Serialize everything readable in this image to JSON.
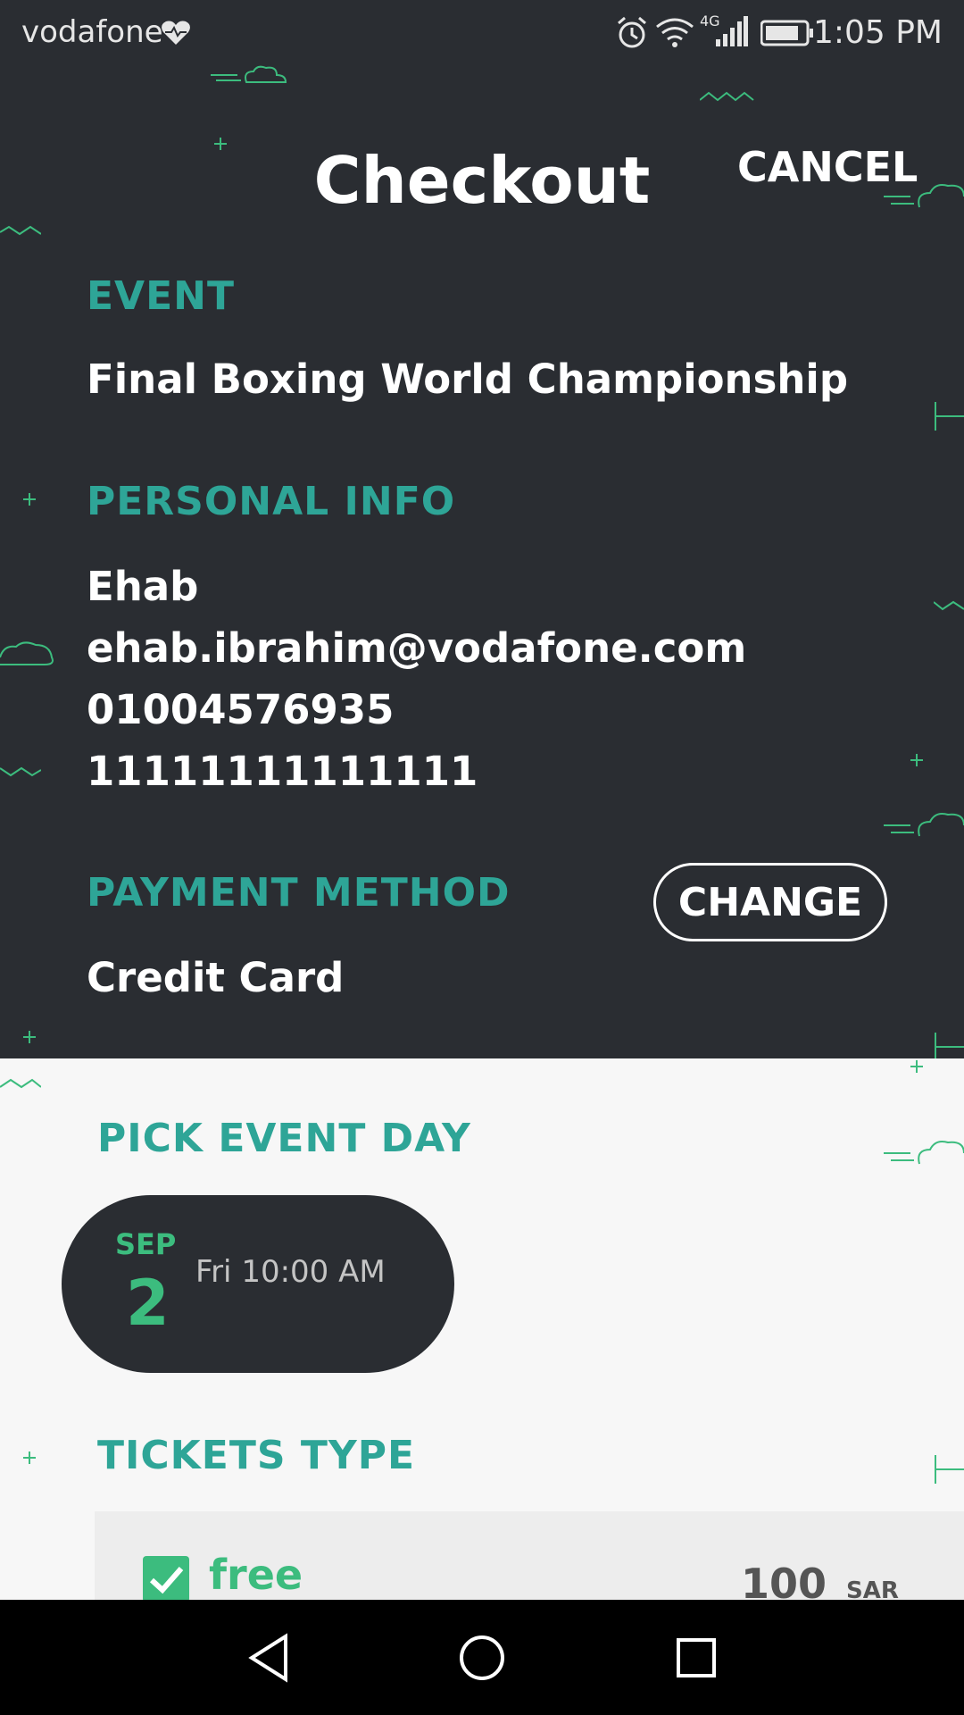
{
  "status_bar": {
    "carrier": "vodafone",
    "time": "1:05 PM",
    "network": "4G"
  },
  "header": {
    "title": "Checkout",
    "cancel_label": "CANCEL"
  },
  "event": {
    "label": "EVENT",
    "name": "Final Boxing World Championship"
  },
  "personal_info": {
    "label": "PERSONAL INFO",
    "name": "Ehab",
    "email": "ehab.ibrahim@vodafone.com",
    "phone": "01004576935",
    "id_number": "11111111111111"
  },
  "payment": {
    "label": "PAYMENT METHOD",
    "method": "Credit Card",
    "change_label": "CHANGE"
  },
  "event_day": {
    "label": "PICK EVENT DAY",
    "month": "SEP",
    "day": "2",
    "time": "Fri 10:00 AM"
  },
  "tickets": {
    "label": "TICKETS TYPE",
    "items": [
      {
        "name": "free",
        "price": "100",
        "currency": "SAR",
        "checked": true
      }
    ]
  },
  "colors": {
    "accent_teal": "#2ea597",
    "accent_green": "#3cbc7e",
    "dark_bg": "#2a2d32",
    "light_bg": "#f7f7f7"
  },
  "icons": [
    "heart-pulse-icon",
    "alarm-icon",
    "wifi-icon",
    "signal-icon",
    "battery-icon",
    "back-icon",
    "home-icon",
    "recents-icon",
    "checkmark-icon"
  ]
}
